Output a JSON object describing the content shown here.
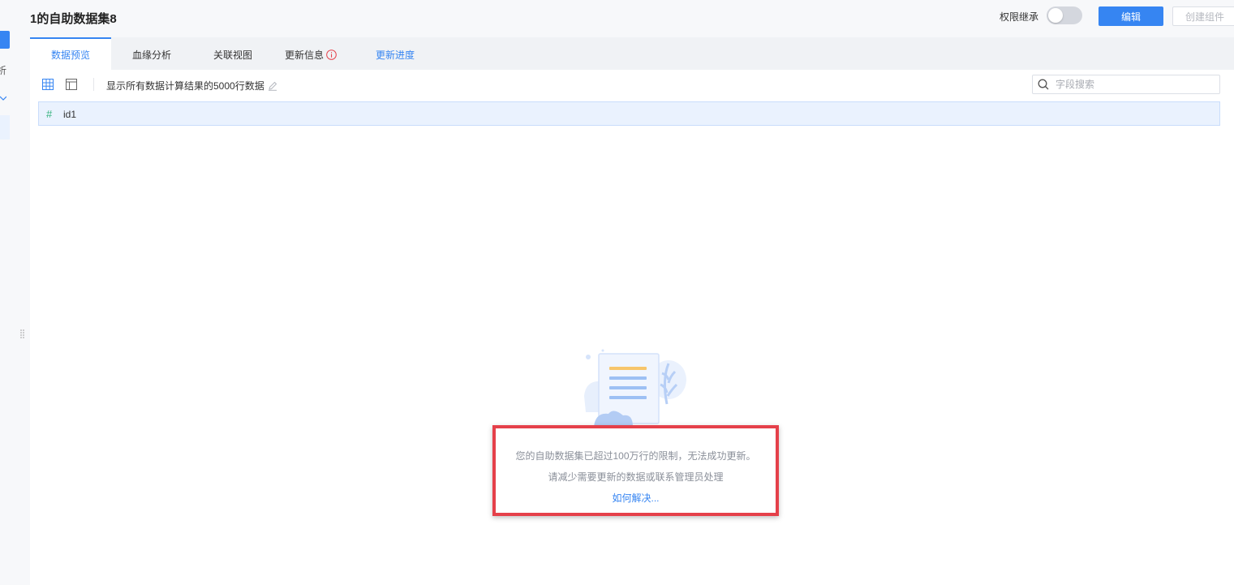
{
  "sidebar": {
    "partial_text": "析"
  },
  "header": {
    "title": "1的自助数据集8",
    "permission_label": "权限继承",
    "permission_toggle_on": false,
    "edit_label": "编辑",
    "create_label": "创建组件"
  },
  "tabs": [
    {
      "label": "数据预览",
      "active": true
    },
    {
      "label": "血缘分析"
    },
    {
      "label": "关联视图"
    },
    {
      "label": "更新信息"
    },
    {
      "label": "更新进度"
    }
  ],
  "toolbar": {
    "description": "显示所有数据计算结果的5000行数据",
    "search_placeholder": "字段搜索"
  },
  "columns": [
    {
      "type_symbol": "#",
      "name": "id1"
    }
  ],
  "empty_state": {
    "line1": "您的自助数据集已超过100万行的限制，无法成功更新。",
    "line2": "请减少需要更新的数据或联系管理员处理",
    "link": "如何解决..."
  },
  "colors": {
    "accent": "#3685f2",
    "highlight_border": "#e5404a",
    "number_type": "#36b37e"
  }
}
